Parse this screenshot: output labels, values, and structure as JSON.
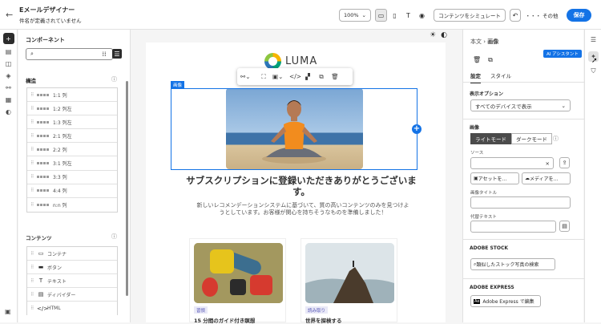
{
  "header": {
    "title": "Eメールデザイナー",
    "subtitle": "件名が定義されていません",
    "zoom": "100%",
    "simulate": "コンテンツをシミュレート",
    "more": "・・・ その他",
    "save": "保存"
  },
  "left_panel": {
    "title": "コンポーネント",
    "search_placeholder": "",
    "structure_heading": "構造",
    "structure_items": [
      "1:1 列",
      "1:2 列左",
      "1:3 列左",
      "2:1 列左",
      "2:2 列",
      "3:1 列左",
      "3:3 列",
      "4:4 列",
      "n:n 列"
    ],
    "content_heading": "コンテンツ",
    "content_items": [
      "コンテナ",
      "ボタン",
      "テキスト",
      "ディバイダー",
      "HTML"
    ]
  },
  "canvas": {
    "brand": "LUMA",
    "selection_tag": "画像",
    "headline": "サブスクリプションに登録いただきありがとうございます。",
    "body": "新しいレコメンデーションシステムに基づいて、質の高いコンテンツのみを見つけようとしています。お客様が関心を持ちそうなものを準備しました！",
    "cards": [
      {
        "tag": "習慣",
        "title": "15 分間のガイド付き瞑想"
      },
      {
        "tag": "読み取り",
        "title": "世界を探検する"
      }
    ]
  },
  "right_panel": {
    "breadcrumb_root": "本文",
    "breadcrumb_current": "画像",
    "ai_assistant": "AI アシスタント",
    "tab_settings": "設定",
    "tab_style": "スタイル",
    "display_options_label": "表示オプション",
    "display_options_value": "すべてのデバイスで表示",
    "image_label": "画像",
    "light_mode": "ライトモード",
    "dark_mode": "ダークモード",
    "source_label": "ソース",
    "asset_button": "アセットを...",
    "media_button": "メディアを...",
    "image_title_label": "画像タイトル",
    "alt_text_label": "代替テキスト",
    "adobe_stock_heading": "ADOBE STOCK",
    "stock_search_button": "類似したストック写真の検索",
    "adobe_express_heading": "ADOBE EXPRESS",
    "express_button": "Adobe Express で編集"
  }
}
